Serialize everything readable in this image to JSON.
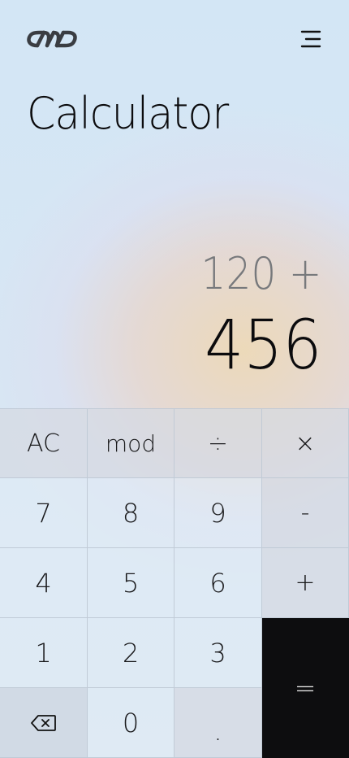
{
  "header": {
    "logo_icon": "infinity-chain-logo-icon",
    "menu_icon": "hamburger-menu-icon"
  },
  "page": {
    "title": "Calculator"
  },
  "display": {
    "expression": "120 +",
    "result": "456"
  },
  "keys": {
    "ac": "AC",
    "mod": "mod",
    "divide": "÷",
    "multiply": "×",
    "seven": "7",
    "eight": "8",
    "nine": "9",
    "minus": "-",
    "four": "4",
    "five": "5",
    "six": "6",
    "plus": "+",
    "one": "1",
    "two": "2",
    "three": "3",
    "equals": "=",
    "backspace_icon": "backspace-icon",
    "zero": "0",
    "dot": "."
  },
  "colors": {
    "equals_bg": "#0d0d0f",
    "text": "#0b0b0d",
    "expression_text": "#77797c"
  }
}
